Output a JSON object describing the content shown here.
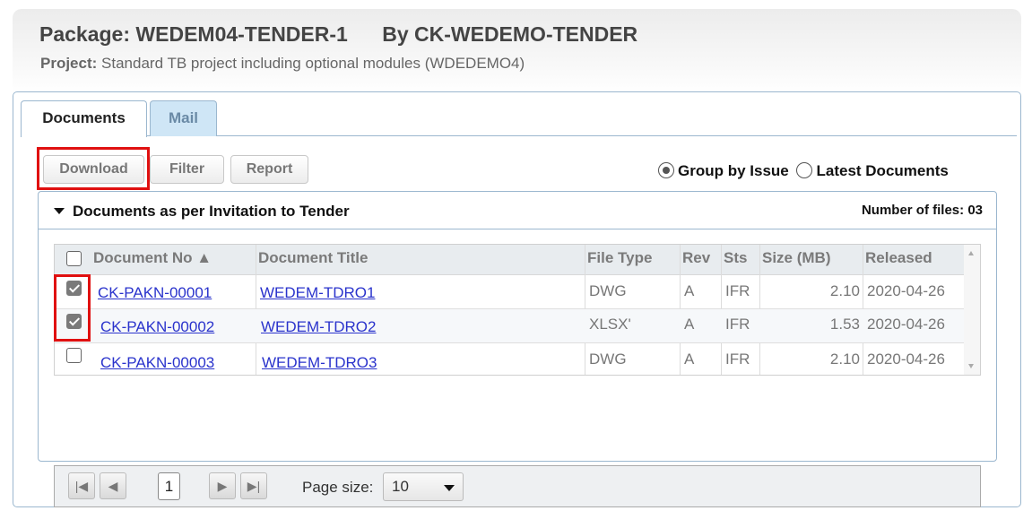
{
  "header": {
    "package_label": "Package:",
    "package_name": "WEDEM04-TENDER-1",
    "by_label": "By",
    "by_name": "CK-WEDEMO-TENDER",
    "project_label": "Project:",
    "project_value": "Standard TB project including optional modules (WDEDEMO4)"
  },
  "tabs": [
    {
      "label": "Documents",
      "active": true
    },
    {
      "label": "Mail",
      "active": false
    }
  ],
  "toolbar": {
    "download_label": "Download",
    "filter_label": "Filter",
    "report_label": "Report"
  },
  "view_options": {
    "group_by_issue": "Group by Issue",
    "latest_documents": "Latest Documents",
    "selected": "group_by_issue"
  },
  "group": {
    "title": "Documents as per Invitation to Tender",
    "file_count": "Number of files: 03"
  },
  "table": {
    "columns": {
      "doc_no": "Document No ▲",
      "title": "Document Title",
      "file_type": "File Type",
      "rev": "Rev",
      "sts": "Sts",
      "size": "Size (MB)",
      "released": "Released"
    },
    "rows": [
      {
        "checked": true,
        "doc_no": "CK-PAKN-00001",
        "title": "WEDEM-TDRO1",
        "file_type": "DWG",
        "rev": "A",
        "sts": "IFR",
        "size": "2.10",
        "released": "2020-04-26"
      },
      {
        "checked": true,
        "doc_no": "CK-PAKN-00002",
        "title": "WEDEM-TDRO2",
        "file_type": "XLSX'",
        "rev": "A",
        "sts": "IFR",
        "size": "1.53",
        "released": "2020-04-26"
      },
      {
        "checked": false,
        "doc_no": "CK-PAKN-00003",
        "title": "WEDEM-TDRO3",
        "file_type": "DWG",
        "rev": "A",
        "sts": "IFR",
        "size": "2.10",
        "released": "2020-04-26"
      }
    ]
  },
  "pager": {
    "current_page": "1",
    "page_size_label": "Page size:",
    "page_size": "10"
  },
  "colors": {
    "highlight": "#e01010",
    "link": "#2a33cc",
    "border": "#9bb7cf",
    "mail_tab": "#cfe6f6"
  }
}
